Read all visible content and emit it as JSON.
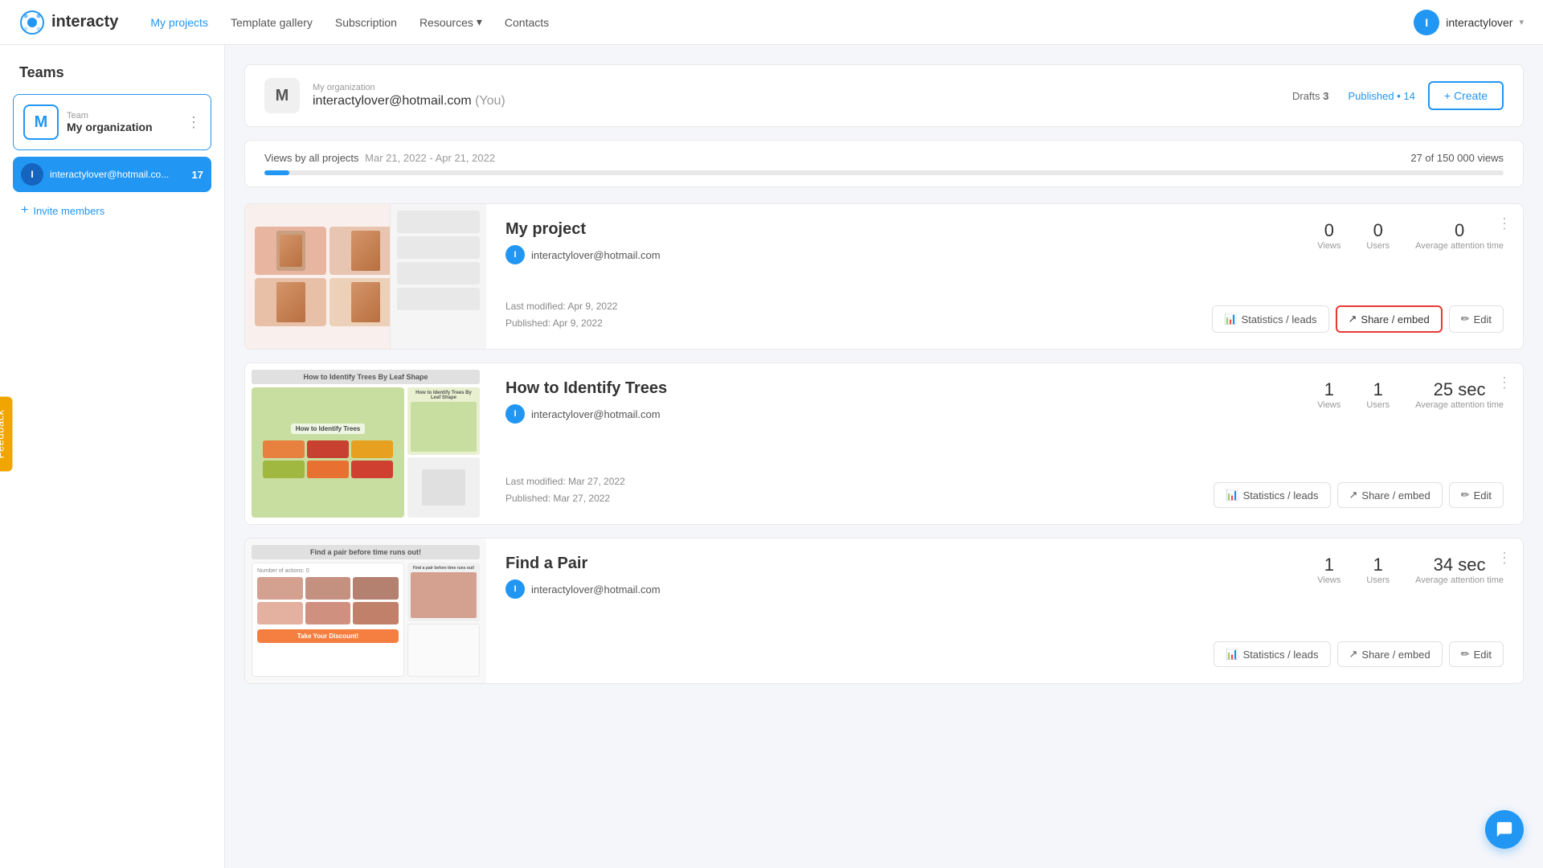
{
  "app": {
    "logo_text": "interacty",
    "nav": {
      "links": [
        {
          "label": "My projects",
          "active": true
        },
        {
          "label": "Template gallery",
          "active": false
        },
        {
          "label": "Subscription",
          "active": false
        },
        {
          "label": "Resources",
          "dropdown": true,
          "active": false
        },
        {
          "label": "Contacts",
          "active": false
        }
      ],
      "user": {
        "initial": "I",
        "username": "interactylover",
        "dropdown": true
      }
    }
  },
  "sidebar": {
    "title": "Teams",
    "team": {
      "label": "Team",
      "name": "My organization",
      "initial": "M"
    },
    "member": {
      "initial": "I",
      "email": "interactylover@hotmail.co...",
      "count": 17
    },
    "invite_label": "Invite members"
  },
  "org_header": {
    "initial": "M",
    "org_name": "My organization",
    "email": "interactylover@hotmail.com",
    "you_label": "(You)",
    "drafts_label": "Drafts",
    "drafts_count": "3",
    "published_label": "Published",
    "published_count": "14",
    "create_label": "+ Create"
  },
  "views_bar": {
    "label": "Views by all projects",
    "date_range": "Mar 21, 2022 - Apr 21, 2022",
    "count_label": "27 of 150 000 views",
    "fill_percent": 0.018
  },
  "projects": [
    {
      "id": "project1",
      "title": "My project",
      "author_initial": "I",
      "author_email": "interactylover@hotmail.com",
      "views": "0",
      "views_label": "Views",
      "users": "0",
      "users_label": "Users",
      "avg_time": "0",
      "avg_time_label": "Average attention time",
      "last_modified": "Last modified: Apr 9, 2022",
      "published": "Published: Apr 9, 2022",
      "actions": {
        "stats_label": "Statistics / leads",
        "share_label": "Share / embed",
        "edit_label": "Edit",
        "share_highlighted": true
      },
      "thumb_type": "grid"
    },
    {
      "id": "project2",
      "title": "How to Identify Trees",
      "author_initial": "I",
      "author_email": "interactylover@hotmail.com",
      "views": "1",
      "views_label": "Views",
      "users": "1",
      "users_label": "Users",
      "avg_time": "25 sec",
      "avg_time_label": "Average attention time",
      "last_modified": "Last modified: Mar 27, 2022",
      "published": "Published: Mar 27, 2022",
      "actions": {
        "stats_label": "Statistics / leads",
        "share_label": "Share / embed",
        "edit_label": "Edit",
        "share_highlighted": false
      },
      "thumb_type": "tree"
    },
    {
      "id": "project3",
      "title": "Find a Pair",
      "author_initial": "I",
      "author_email": "interactylover@hotmail.com",
      "views": "1",
      "views_label": "Views",
      "users": "1",
      "users_label": "Users",
      "avg_time": "34 sec",
      "avg_time_label": "Average attention time",
      "last_modified": "",
      "published": "",
      "actions": {
        "stats_label": "Statistics / leads",
        "share_label": "Share / embed",
        "edit_label": "Edit",
        "share_highlighted": false
      },
      "thumb_type": "pair"
    }
  ],
  "feedback": {
    "label": "Feedback"
  },
  "chat": {
    "icon": "💬"
  }
}
